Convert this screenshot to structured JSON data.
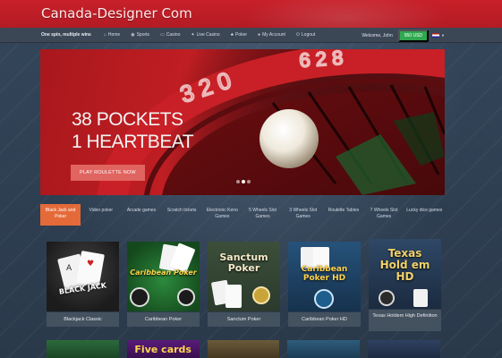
{
  "site": {
    "title": "Canada-Designer Com"
  },
  "nav": {
    "tagline": "One spin, multiple wins",
    "items": [
      {
        "label": "Home",
        "icon": "home-icon"
      },
      {
        "label": "Sports",
        "icon": "sports-icon"
      },
      {
        "label": "Casino",
        "icon": "casino-icon"
      },
      {
        "label": "Live Casino",
        "icon": "live-casino-icon"
      },
      {
        "label": "Poker",
        "icon": "poker-icon"
      },
      {
        "label": "My Account",
        "icon": "account-icon"
      },
      {
        "label": "Logout",
        "icon": "logout-icon"
      }
    ],
    "welcome": "Welcome, John",
    "balance": "950 USD",
    "language_flag": "us-flag-icon"
  },
  "hero": {
    "line1": "38 POCKETS",
    "line2": "1 HEARTBEAT",
    "cta": "PLAY ROULETTE NOW",
    "slides": 3,
    "active_slide": 2
  },
  "categories": [
    {
      "label": "Black Jack and Poker",
      "active": true
    },
    {
      "label": "Video poker"
    },
    {
      "label": "Arcade games"
    },
    {
      "label": "Scratch tickets"
    },
    {
      "label": "Electronic Keno Games"
    },
    {
      "label": "5 Wheels Slot Games"
    },
    {
      "label": "3 Wheels Slot Games"
    },
    {
      "label": "Roulette Tables"
    },
    {
      "label": "7 Wheels Slot Games"
    },
    {
      "label": "Lucky dice games"
    }
  ],
  "games": [
    {
      "label": "Blackjack Classic",
      "art": "BLACK JACK"
    },
    {
      "label": "Caribbean Poker",
      "art": "Caribbean Poker"
    },
    {
      "label": "Sanctum Poker",
      "art": "Sanctum Poker"
    },
    {
      "label": "Caribbean Poker HD",
      "art": "Caribbean Poker HD"
    },
    {
      "label": "Texas Holdem High Definition",
      "art": "Texas Hold em HD"
    }
  ],
  "second_row": [
    {
      "art": ""
    },
    {
      "art": "Five cards"
    },
    {
      "art": ""
    },
    {
      "art": ""
    },
    {
      "art": ""
    }
  ],
  "colors": {
    "brand_red": "#c8202a",
    "accent_orange": "#e56a39",
    "balance_green": "#2fa84f",
    "cta_salmon": "#e0645f"
  }
}
